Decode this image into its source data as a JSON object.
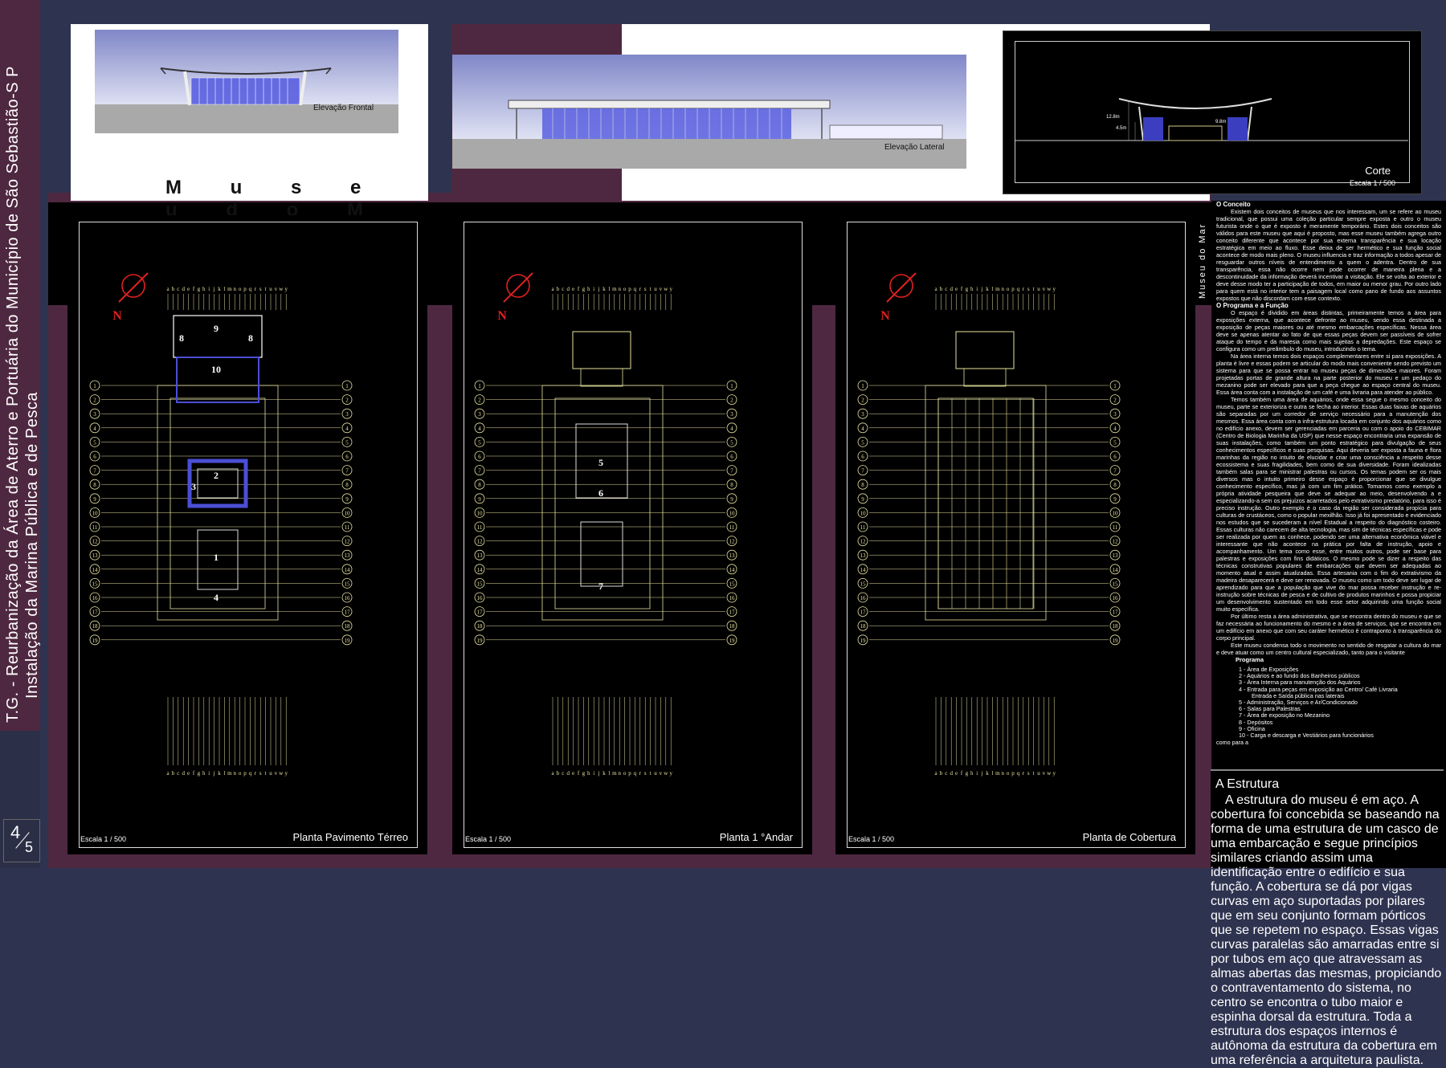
{
  "sidebar": {
    "title_line1": "T.G. - Reurbanização da Área de Aterro e Portuária do Município de São Sebastião-S P",
    "title_line2": "Instalação da Marina Pública e de Pesca",
    "page_numerator": "4",
    "page_denominator": "5"
  },
  "header": {
    "museum_title": "M u s e u   d o   M a r",
    "front_caption": "Elevação Frontal",
    "lateral_caption": "Elevação Lateral",
    "section_caption": "Corte",
    "section_scale": "Escala 1 / 500",
    "dim_a": "12.8m",
    "dim_b": "4.5m",
    "dim_c": "9.8m"
  },
  "plans": [
    {
      "title": "Planta Pavimento Térreo",
      "scale": "Escala 1 / 500",
      "north": "N",
      "room_labels": [
        "9",
        "8",
        "8",
        "10",
        "2",
        "3",
        "1",
        "4"
      ]
    },
    {
      "title": "Planta 1 °Andar",
      "scale": "Escala 1 / 500",
      "north": "N",
      "room_labels": [
        "5",
        "6",
        "7"
      ]
    },
    {
      "title": "Planta de Cobertura",
      "scale": "Escala 1 / 500",
      "north": "N",
      "room_labels": []
    }
  ],
  "grid": {
    "row_labels": [
      "1",
      "2",
      "3",
      "4",
      "5",
      "6",
      "7",
      "8",
      "9",
      "10",
      "11",
      "12",
      "13",
      "14",
      "15",
      "16",
      "17",
      "18",
      "19"
    ],
    "col_letters": "abcdefghijklmnopqrstuvwy"
  },
  "text_column": {
    "vertical_label": "Museu do Mar",
    "conceito_title": "O Conceito",
    "conceito_body": "Existem dois conceitos de museus que nos interessam, um se refere ao museu tradicional, que possui uma coleção particular sempre exposta e outro o museu futurista onde o que é exposto é meramente temporário. Estes dois conceitos são válidos para este museu que aqui é proposto, mas esse museu também agrega outro conceito diferente que acontece por sua externa transparência e sua locação estratégica em meio ao fluxo. Esse deixa de ser hermético e sua função social acontece de modo mais pleno. O museu influencia e traz informação a todos apesar de resguardar outros níveis de entendimento a quem o adentra. Dentro de sua transparência, essa não ocorre nem pode ocorrer de maneira plena e a descontinuidade da informação deverá incentivar a visitação. Ele se volta ao exterior e deve desse modo ter a participação de todos, em maior ou menor grau. Por outro lado para quem está no interior tem a paisagem local como pano de fundo aos assuntos expostos que não discordam com esse contexto.",
    "programa_title": "O Programa e a Função",
    "programa_body1": "O espaço é dividido em áreas distintas, primeiramente temos a área para exposições externa, que acontece defronte ao museu, sendo essa destinada a exposição de peças maiores ou até mesmo embarcações específicas. Nessa área deve se apenas atentar ao fato de que essas peças devem ser passíveis de sofrer ataque do tempo e da maresia como mais sujeitas a depredações. Este espaço se configura como um preâmbulo do museu, introduzindo o tema.",
    "programa_body2": "Na área interna temos dois espaços complementares entre si para exposições. A planta é livre e essas podem se articular do modo mais conveniente sendo previsto um sistema para que se possa entrar no museu peças de dimensões maiores. Foram projetadas portas de grande altura na parte posterior do museu e um pedaço do mezanino pode ser elevado para que a peça chegue ao espaço central do museu. Essa área conta com a instalação de um café e uma livraria para atender ao público.",
    "programa_body3": "Temos também uma área de aquários, onde essa segue o mesmo conceito do museu, parte se exterioriza e outra se fecha ao interior. Essas duas faixas de aquários são separadas por um corredor de serviço necessário para a manutenção dos mesmos. Essa área conta com a infra-estrutura locada em conjunto dos aquários como no edifício anexo, devem ser gerenciadas em parceria ou com o apoio do CEBIMAR (Centro de Biologia Marinha da USP) que nesse espaço encontraria uma expansão de suas instalações, como também um ponto estratégico para divulgação de seus conhecimentos específicos e suas pesquisas. Aqui deveria ser exposta a fauna e flora marinhas da região no intuito de elucidar e criar uma consciência a respeito desse ecossistema e suas fragilidades, bem como de sua diversidade. Foram idealizadas também salas para se ministrar palestras ou cursos. Os temas podem ser os mais diversos mas o intuito primeiro desse espaço é proporcionar que se divulgue conhecimento específico, mas já com um fim prático. Tomamos como exemplo a própria atividade pesqueira que deve se adequar ao meio, desenvolvendo a e especializando-a sem os prejuízos acarretados pelo extrativismo predatório, para isso é preciso instrução. Outro exemplo é o caso da região ser considerada propícia para culturas de crustáceos, como o popular mexilhão. Isso já foi apresentado e evidenciado nos estudos que se sucederam a nível Estadual a respeito do diagnóstico costeiro. Essas culturas não carecem de alta tecnologia, mas sim de técnicas específicas e pode ser realizada por quem as conhece, podendo ser uma alternativa econômica viável e interessante que não acontece na prática por falta de instrução, apoio e acompanhamento. Um tema como esse, entre muitos outros, pode ser base para palestras e exposições com fins didáticos. O mesmo pode se dizer a respeito das técnicas construtivas populares de embarcações que devem ser adequadas ao momento atual e assim atualizadas. Essa artesania com o fim do extrativismo da madeira desaparecerá e deve ser renovada. O museu como um todo deve ser lugar de aprendizado para que a população que vive do mar possa receber instrução e re-instrução sobre técnicas de pesca e de cultivo de produtos marinhos e possa propiciar um desenvolvimento sustentado em todo esse setor adquirindo uma função social muito específica.",
    "programa_body4": "Por último resta a área administrativa, que se encontra dentro do museu e que se faz necessária ao funcionamento do mesmo e a área de serviços, que se encontra em um edifício em anexo que com seu caráter hermético é contraponto à transparência do corpo principal.",
    "programa_body5": "Este museu condensa todo o movimento no sentido de resgatar a cultura do mar e deve atuar como um centro cultural especializado, tanto para o visitante",
    "programa_list_title": "Programa",
    "programa_list": [
      "1  -  Área de Exposições",
      "2  -  Aquários e ao fundo dos Banheiros públicos",
      "3  -       Área Interna para manutenção dos Aquários",
      "4  -  Entrada para peças em exposição ao Centro/ Café Livraria",
      "        Entrada e Saída pública nas laterais",
      "5  -  Administração, Serviços e Ar/Condicionado",
      "6  -  Salas para Palestras",
      "7  -  Área de exposição no Mezanino",
      "8  -  Depósitos",
      "9  -  Oficina",
      "10 -  Carga e descarga e Vestiários para funcionários"
    ],
    "programa_tail": "como para a",
    "estrutura_title": "A Estrutura",
    "estrutura_body": "A estrutura do museu é em aço. A cobertura foi concebida se baseando na forma de uma estrutura de um casco de uma embarcação e segue princípios similares criando assim uma identificação entre o edifício e sua função. A cobertura se dá por vigas curvas em aço suportadas por pilares que em seu conjunto formam pórticos que se repetem no espaço. Essas vigas curvas paralelas são amarradas entre si por tubos em aço que atravessam as almas abertas das mesmas, propiciando o contraventamento do sistema, no centro se encontra o tubo maior e espinha dorsal da estrutura. Toda a estrutura dos espaços internos é autônoma da estrutura da cobertura em uma referência a arquitetura paulista."
  },
  "colors": {
    "maroon": "#4e2840",
    "navy": "#2e3350",
    "cad_yellow": "#e8e3a0",
    "blueprint_blue": "#4b4fd6",
    "north_red": "#e02020"
  }
}
